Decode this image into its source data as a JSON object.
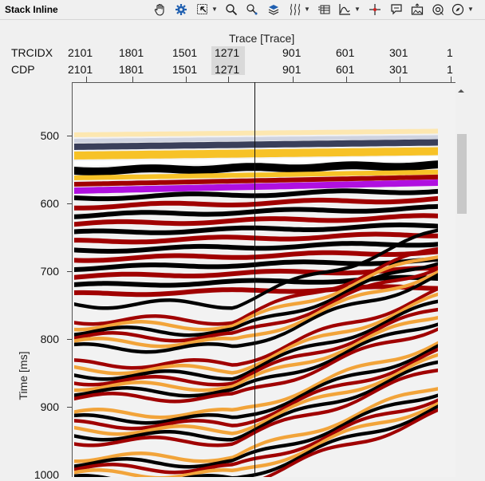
{
  "window": {
    "title": "Stack Inline"
  },
  "toolbar": {
    "icons": [
      "hand-icon",
      "gear-icon",
      "zoom-box-icon",
      "magnifier-icon",
      "pick-icon",
      "layers-icon",
      "wiggle-icon",
      "table-icon",
      "chart-icon",
      "crosshair-icon",
      "comment-icon",
      "export-image-icon",
      "snapshot-icon",
      "compass-icon"
    ]
  },
  "header": {
    "axis_title": "Trace [Trace]",
    "rows": [
      {
        "label": "TRCIDX",
        "values": [
          "2101",
          "1801",
          "1501",
          "1271",
          "901",
          "601",
          "301",
          "1"
        ]
      },
      {
        "label": "CDP",
        "values": [
          "2101",
          "1801",
          "1501",
          "1271",
          "901",
          "601",
          "301",
          "1"
        ]
      }
    ]
  },
  "yaxis": {
    "label": "Time [ms]",
    "ticks": [
      "500",
      "600",
      "700",
      "800",
      "900",
      "1000"
    ]
  },
  "colors": {
    "seismic_black": "#000000",
    "seismic_red": "#a00000",
    "seismic_yellow": "#f7c227",
    "horizon": "#b010e0"
  }
}
